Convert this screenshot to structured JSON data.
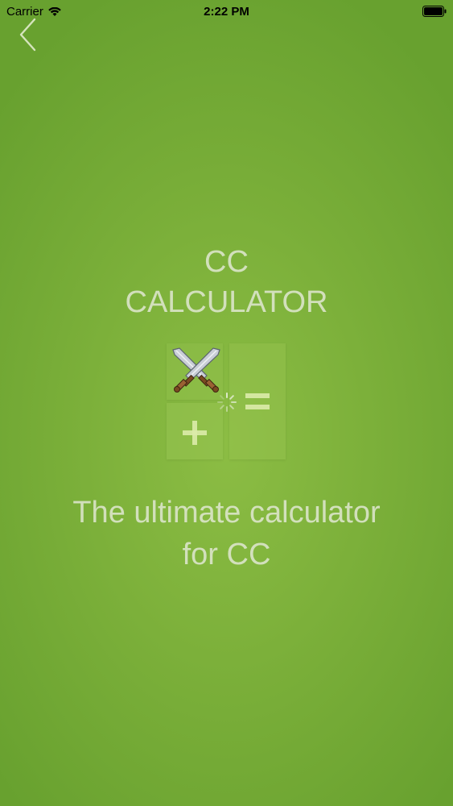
{
  "status_bar": {
    "carrier": "Carrier",
    "time": "2:22 PM"
  },
  "nav": {
    "back_icon": "chevron-left-icon"
  },
  "splash": {
    "title_line1": "CC",
    "title_line2": "CALCULATOR",
    "tagline_line1": "The ultimate calculator",
    "tagline_line2": "for CC",
    "logo_icons": [
      "crossed-swords-icon",
      "plus-icon",
      "equals-icon",
      "loading-spinner-icon"
    ]
  },
  "colors": {
    "background": "#7cb03a",
    "text": "#e1e8d2"
  }
}
